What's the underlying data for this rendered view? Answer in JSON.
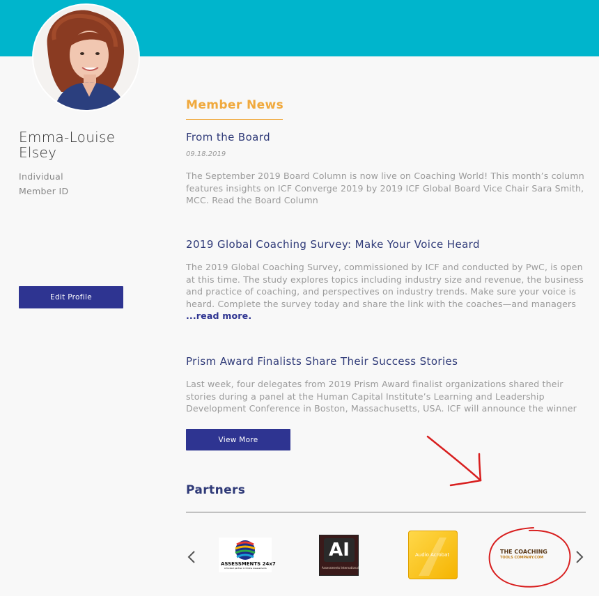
{
  "profile": {
    "name": "Emma-Louise Elsey",
    "type": "Individual",
    "member_id_label": "Member ID",
    "edit_button": "Edit Profile"
  },
  "news": {
    "heading": "Member News",
    "items": [
      {
        "title": "From the Board",
        "date": "09.18.2019",
        "body": "The September 2019 Board Column is now live on Coaching World! This month’s column features insights on ICF Converge 2019 by 2019 ICF Global Board Vice Chair Sara Smith, MCC. Read the Board Column"
      },
      {
        "title": "2019 Global Coaching Survey: Make Your Voice Heard",
        "body": "The 2019 Global Coaching Survey, commissioned by ICF and conducted by PwC, is open at this time. The study explores topics including industry size and revenue, the business and practice of coaching, and perspectives on industry trends. Make sure your voice is heard. Complete the survey today and share the link with the coaches—and managers ",
        "read_more": "...read more."
      },
      {
        "title": "Prism Award Finalists Share Their Success Stories",
        "body": "Last week, four delegates from 2019 Prism Award finalist organizations shared their stories during a panel at the Human Capital Institute’s Learning and Leadership Development Conference in Boston, Massachusetts, USA. ICF will announce the winner of"
      }
    ],
    "view_more": "View More"
  },
  "partners": {
    "heading": "Partners",
    "logos": [
      {
        "name": "ASSESSMENTS 24x7",
        "tagline": "A trusted partner in Online Assessments"
      },
      {
        "name": "AI",
        "tagline": "Assessments International"
      },
      {
        "name": "Audio Acrobat"
      },
      {
        "name": "THE COACHING",
        "name_line2": "TOOLS COMPANY.COM"
      }
    ]
  },
  "colors": {
    "header": "#00b5cc",
    "accent": "#f0a93d",
    "primary_button": "#2e3491",
    "title_text": "#2f3a78",
    "annotation": "#d81f1f"
  },
  "icons": {
    "prev": "chevron-left-icon",
    "next": "chevron-right-icon"
  }
}
